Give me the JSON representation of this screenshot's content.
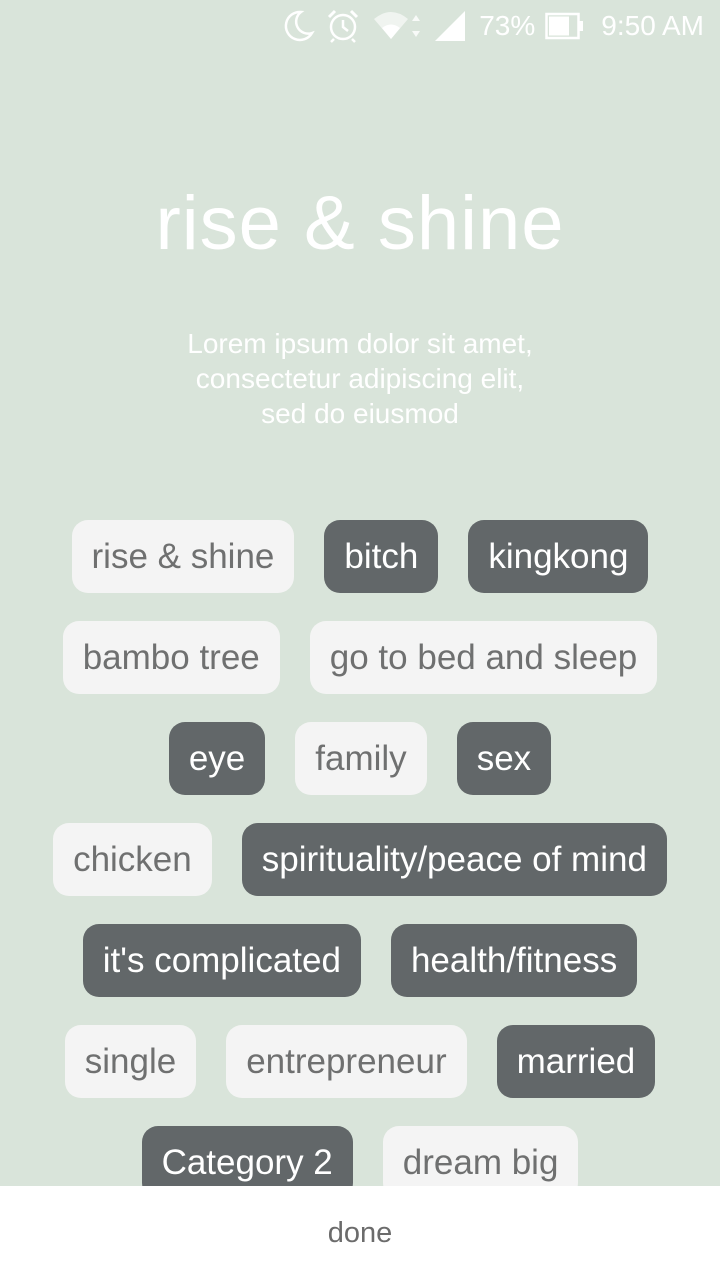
{
  "status_bar": {
    "battery_percent": "73%",
    "time": "9:50 AM",
    "icons": [
      "moon-icon",
      "alarm-icon",
      "wifi-icon",
      "signal-icon",
      "battery-icon"
    ]
  },
  "header": {
    "title": "rise & shine",
    "subtitle_lines": [
      "Lorem ipsum dolor sit amet,",
      "consectetur adipiscing elit,",
      "sed do eiusmod"
    ]
  },
  "tags": {
    "rows": [
      [
        {
          "label": "rise & shine",
          "selected": false
        },
        {
          "label": "bitch",
          "selected": true
        },
        {
          "label": "kingkong",
          "selected": true
        }
      ],
      [
        {
          "label": "bambo tree",
          "selected": false
        },
        {
          "label": "go to bed and sleep",
          "selected": false
        }
      ],
      [
        {
          "label": "eye",
          "selected": true
        },
        {
          "label": "family",
          "selected": false
        },
        {
          "label": "sex",
          "selected": true
        }
      ],
      [
        {
          "label": "chicken",
          "selected": false
        },
        {
          "label": "spirituality/peace of mind",
          "selected": true
        }
      ],
      [
        {
          "label": "it's complicated",
          "selected": true
        },
        {
          "label": "health/fitness",
          "selected": true
        }
      ],
      [
        {
          "label": "single",
          "selected": false
        },
        {
          "label": "entrepreneur",
          "selected": false
        },
        {
          "label": "married",
          "selected": true
        }
      ],
      [
        {
          "label": "Category 2",
          "selected": true
        },
        {
          "label": "dream big",
          "selected": false
        }
      ]
    ]
  },
  "footer": {
    "done_label": "done"
  },
  "colors": {
    "background": "#d9e4da",
    "tag_selected": "#626769",
    "tag_unselected": "#f4f4f4"
  }
}
